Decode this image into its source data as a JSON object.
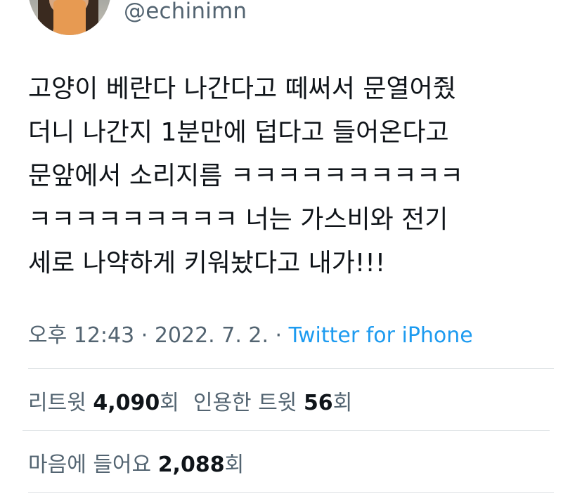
{
  "user": {
    "handle": "@echinimn"
  },
  "tweet": {
    "lines": [
      "고양이 베란다 나간다고 떼써서 문열어줬",
      "더니 나간지 1분만에 덥다고 들어온다고",
      "문앞에서 소리지름 ㅋㅋㅋㅋㅋㅋㅋㅋㅋㅋ",
      "ㅋㅋㅋㅋㅋㅋㅋㅋㅋ 너는 가스비와 전기",
      "세로 나약하게 키워놨다고 내가!!!"
    ]
  },
  "meta": {
    "time": "오후 12:43",
    "separator1": " · ",
    "date": "2022. 7. 2.",
    "separator2": " · ",
    "source": "Twitter for iPhone"
  },
  "stats": {
    "retweets_label": "리트윗 ",
    "retweets_count": "4,090",
    "retweets_unit": "회",
    "quotes_label": "인용한 트윗 ",
    "quotes_count": "56",
    "quotes_unit": "회",
    "likes_label": "마음에 들어요 ",
    "likes_count": "2,088",
    "likes_unit": "회"
  },
  "colors": {
    "text": "#0f1419",
    "secondary": "#536471",
    "link": "#1d9bf0",
    "divider": "#dfe3e6"
  }
}
